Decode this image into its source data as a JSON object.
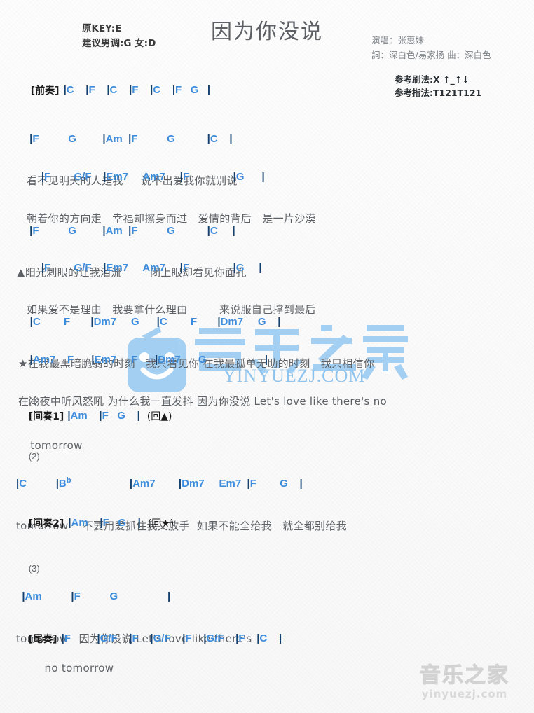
{
  "header": {
    "title": "因为你没说",
    "original_key": "原KEY:E",
    "suggested_key": "建议男调:G 女:D",
    "singer": "演唱：张惠妹",
    "writers": "詞：深白色/易家扬   曲：深白色",
    "strumming": "参考刷法:X ↑_↑↓",
    "fingering": "参考指法:T121T121"
  },
  "watermark": {
    "center_text": "YINYUEZJ.COM",
    "bottom_cn": "音乐之家",
    "bottom_en": "yinyuezj.com"
  },
  "sections": {
    "prelude": {
      "label": "[前奏]",
      "chords": "|C    |F    |C    |F    |C    |F   G   |"
    },
    "verse1": {
      "line1_chords": " |F          G         |Am  |F          G           |C    |",
      "line1_lyrics": "看不见明天的人是我     说不出爱我你就别说",
      "line2_chords": "     |F        G/F    |Em7     Am7     |F               |G      |",
      "line2_lyrics": "朝着你的方向走   幸福却擦身而过   爱情的背后   是一片沙漠"
    },
    "verse2": {
      "line1_chords": " |F          G         |Am  |F          G           |C     |",
      "line1_lyrics": "▲阳光刺眼的让我泪流        闭上眼却看见你面孔",
      "line2_chords": "     |F        G/F    |Em7     Am7     |F               |G     |",
      "line2_lyrics": "如果爱不是理由   我要拿什么理由         来说服自己撑到最后"
    },
    "chorus": {
      "line1_chords": "    |C        F       |Dm7     G      |C        F       |Dm7     G    |",
      "line1_lyrics": "★在我最黑暗脆弱的时刻   我只看见你 在我最孤单无助的时刻   我只相信你",
      "line2_chords": "    |Am7    F      |Em7     F      |Dm7      G                    |",
      "line2_lyrics": "在冷夜中听风怒吼 为什么我一直发抖 因为你没说 Let's love like there's no"
    },
    "interlude1": {
      "number": "(1)",
      "label": "[间奏1]",
      "chords": "|Am    |F   G    |",
      "repeat": "(回▲)",
      "lyrics": "    tomorrow"
    },
    "bridge": {
      "number": "(2)",
      "chords": "|C          |B♭                    |Am7        |Dm7     Em7  |F        G    |",
      "lyrics": "tomorrow    不要用爱抓住我又放手  如果不能全给我   就全都别给我"
    },
    "interlude2": {
      "label": "[间奏2]",
      "chords": "|Am    |F   G    |",
      "repeat": "(回★)"
    },
    "outro_verse": {
      "number": "(3)",
      "chords": "  |Am          |F          G                 |",
      "lyrics": "tomorrow   因为你没说 Let's love like there's"
    },
    "coda": {
      "label": "[尾奏]",
      "chords": "|F         |G/F    |F    |G/F    |F    |G/F    |F    |C    |",
      "lyrics": "        no tomorrow"
    }
  }
}
